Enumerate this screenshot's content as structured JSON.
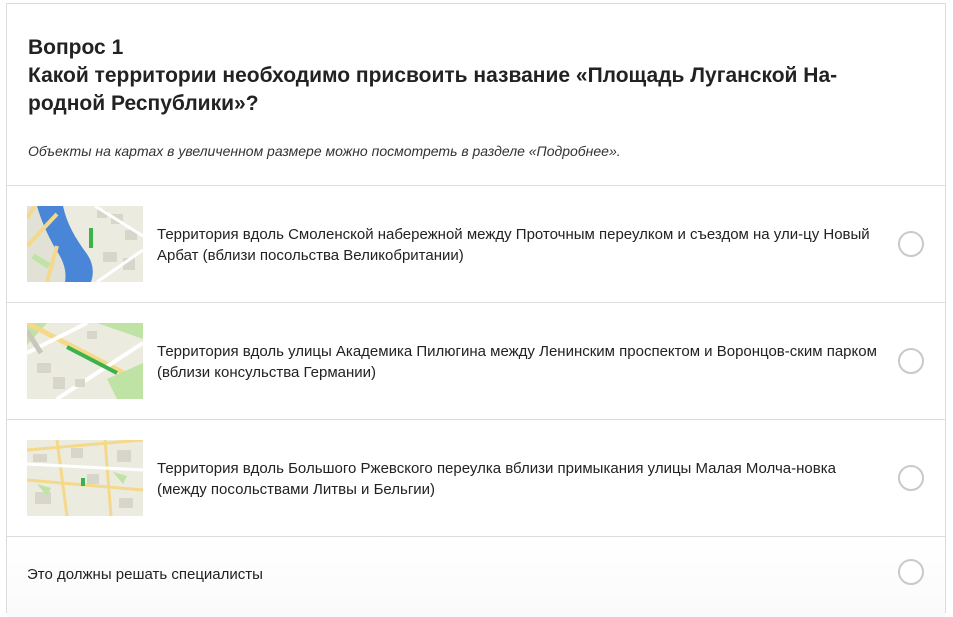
{
  "question": {
    "number": "Вопрос 1",
    "title": "Какой территории необходимо присвоить название «Площадь Луганской На-родной Республики»?",
    "hint": "Объекты на картах в увеличенном размере можно посмотреть в разделе «Подробнее»."
  },
  "options": [
    {
      "text": "Территория вдоль Смоленской набережной между Проточным переулком и съездом на ули-цу Новый Арбат (вблизи посольства Великобритании)",
      "thumbnail_icon": "map-thumbnail"
    },
    {
      "text": "Территория вдоль улицы Академика Пилюгина между Ленинским проспектом и Воронцов-ским парком (вблизи консульства Германии)",
      "thumbnail_icon": "map-thumbnail"
    },
    {
      "text": "Территория вдоль Большого Ржевского переулка вблизи примыкания улицы Малая Молча-новка (между посольствами Литвы и Бельгии)",
      "thumbnail_icon": "map-thumbnail"
    },
    {
      "text": "Это должны решать специалисты"
    }
  ],
  "colors": {
    "map_land": "#ecebdf",
    "map_water": "#4a86d8",
    "map_green": "#bfe3a4",
    "map_highlight": "#3bb34a",
    "map_road": "#f5d98a",
    "radio_border": "#c9c9c9",
    "divider": "#dcdcdc"
  }
}
